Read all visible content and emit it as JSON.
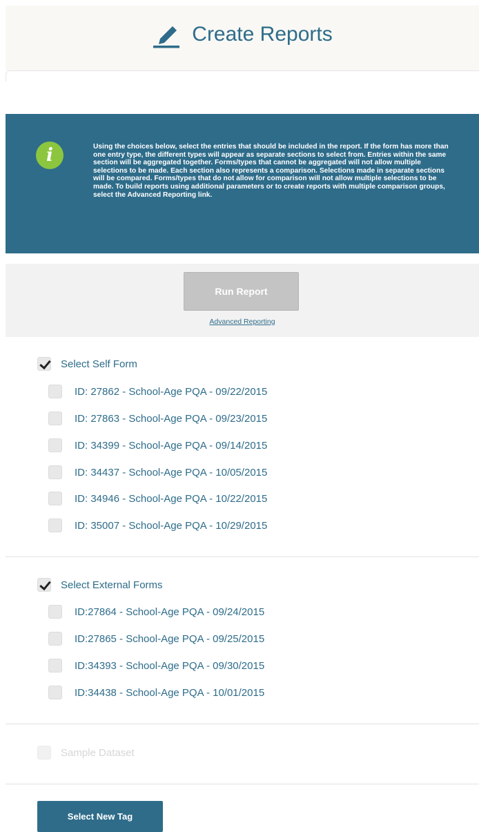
{
  "header": {
    "title": "Create Reports",
    "icon": "pencil-icon"
  },
  "info": {
    "icon_letter": "i",
    "text": "Using the choices below, select the entries that should be included in the report. If the form has more than one entry type, the different types will appear as separate sections to select from. Entries within the same section will be aggregated together. Forms/types that cannot be aggregated will not allow multiple selections to be made. Each section also represents a comparison. Selections made in separate sections will be compared. Forms/types that do not allow for comparison will not allow multiple selections to be made. To build reports using additional parameters or to create reports with multiple comparison groups, select the Advanced Reporting link."
  },
  "actions": {
    "run_report": "Run Report",
    "advanced_reporting": "Advanced Reporting"
  },
  "self_form": {
    "label": "Select Self Form",
    "checked": true,
    "items": [
      "ID: 27862 - School-Age PQA - 09/22/2015",
      "ID: 27863 - School-Age PQA - 09/23/2015",
      "ID: 34399 - School-Age PQA - 09/14/2015",
      "ID: 34437 - School-Age PQA - 10/05/2015",
      "ID: 34946 - School-Age PQA - 10/22/2015",
      "ID: 35007 - School-Age PQA - 10/29/2015"
    ]
  },
  "external_forms": {
    "label": "Select External Forms",
    "checked": true,
    "items": [
      "ID:27864 - School-Age PQA - 09/24/2015",
      "ID:27865 - School-Age PQA - 09/25/2015",
      "ID:34393 - School-Age PQA - 09/30/2015",
      "ID:34438 - School-Age PQA - 10/01/2015"
    ]
  },
  "sample_dataset": {
    "label": "Sample Dataset",
    "disabled": true
  },
  "footer": {
    "select_new_tag": "Select New Tag"
  },
  "colors": {
    "primary": "#2e6c8a",
    "info_icon": "#8cc63f",
    "run_button_disabled": "#c4c4c4"
  }
}
